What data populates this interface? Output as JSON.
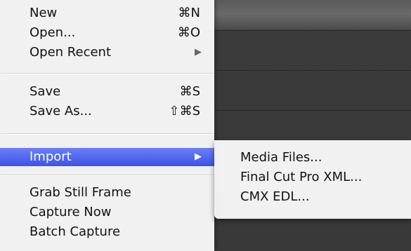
{
  "menu": {
    "items": [
      {
        "label": "New",
        "shortcut": "⌘N"
      },
      {
        "label": "Open...",
        "shortcut": "⌘O"
      },
      {
        "label": "Open Recent",
        "arrow": "▶"
      },
      {
        "label": "Save",
        "shortcut": "⌘S"
      },
      {
        "label": "Save As...",
        "shortcut": "⇧⌘S"
      },
      {
        "label": "Import",
        "arrow": "▶",
        "highlighted": true
      },
      {
        "label": "Grab Still Frame"
      },
      {
        "label": "Capture Now"
      },
      {
        "label": "Batch Capture"
      }
    ]
  },
  "submenu": {
    "items": [
      {
        "label": "Media Files..."
      },
      {
        "label": "Final Cut Pro XML..."
      },
      {
        "label": "CMX EDL..."
      }
    ]
  },
  "colors": {
    "highlight": "#4a60f0",
    "menu_bg": "#f7f7f7",
    "app_bg": "#3a3a3a"
  }
}
